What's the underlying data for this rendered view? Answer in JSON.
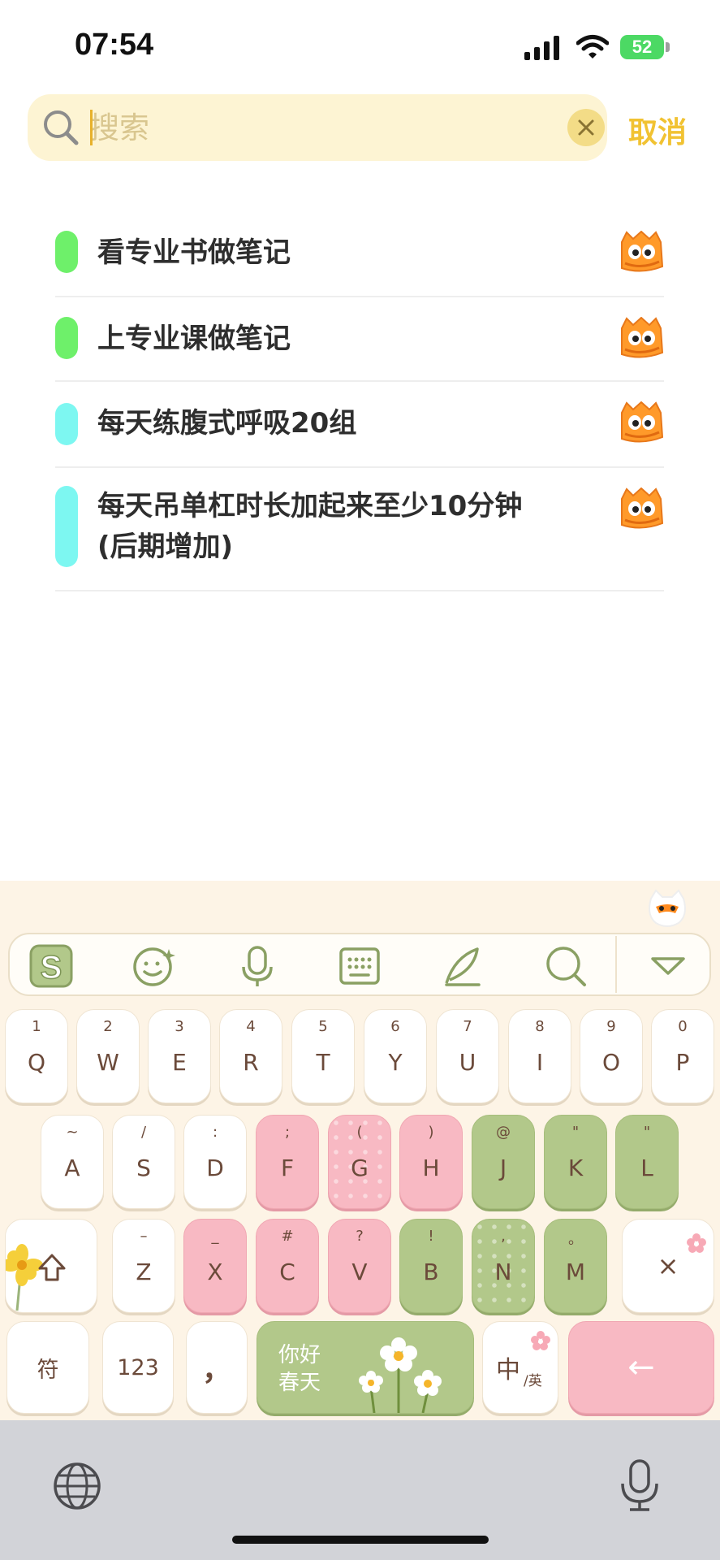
{
  "status_bar": {
    "time": "07:54",
    "battery": "52"
  },
  "search": {
    "placeholder": "搜索",
    "cancel_label": "取消"
  },
  "list": [
    {
      "title": "看专业书做笔记",
      "color": "#6ef06a"
    },
    {
      "title": "上专业课做笔记",
      "color": "#6ef06a"
    },
    {
      "title": "每天练腹式呼吸20组",
      "color": "#7df7f1"
    },
    {
      "title": "每天吊单杠时长加起来至少10分钟\n(后期增加)",
      "color": "#7df7f1"
    }
  ],
  "keyboard": {
    "row1": [
      {
        "sub": "1",
        "main": "Q"
      },
      {
        "sub": "2",
        "main": "W"
      },
      {
        "sub": "3",
        "main": "E"
      },
      {
        "sub": "4",
        "main": "R"
      },
      {
        "sub": "5",
        "main": "T"
      },
      {
        "sub": "6",
        "main": "Y"
      },
      {
        "sub": "7",
        "main": "U"
      },
      {
        "sub": "8",
        "main": "I"
      },
      {
        "sub": "9",
        "main": "O"
      },
      {
        "sub": "0",
        "main": "P"
      }
    ],
    "row2": [
      {
        "sub": "~",
        "main": "A"
      },
      {
        "sub": "/",
        "main": "S"
      },
      {
        "sub": ":",
        "main": "D"
      },
      {
        "sub": ";",
        "main": "F"
      },
      {
        "sub": "(",
        "main": "G"
      },
      {
        "sub": ")",
        "main": "H"
      },
      {
        "sub": "@",
        "main": "J"
      },
      {
        "sub": "\"",
        "main": "K"
      },
      {
        "sub": "\"",
        "main": "L"
      }
    ],
    "row3": [
      {
        "sub": "–",
        "main": "Z"
      },
      {
        "sub": "_",
        "main": "X"
      },
      {
        "sub": "#",
        "main": "C"
      },
      {
        "sub": "?",
        "main": "V"
      },
      {
        "sub": "!",
        "main": "B"
      },
      {
        "sub": ",",
        "main": "N"
      },
      {
        "sub": "。",
        "main": "M"
      }
    ],
    "delete_label": "×",
    "symbols_label": "符",
    "numbers_label": "123",
    "comma_label": "，",
    "space_line1": "你好",
    "space_line2": "春天",
    "lang_main": "中",
    "lang_sub": "/英",
    "enter_label": "←"
  },
  "colors": {
    "accent": "#f1c232",
    "pink_key": "#f8b9c3",
    "green_key": "#b2c88a"
  },
  "icons": [
    "search-icon",
    "clear-icon",
    "mascot-icon",
    "sogou-logo-icon",
    "emoji-icon",
    "mic-icon",
    "keyboard-icon",
    "pen-icon",
    "search-icon",
    "collapse-icon",
    "shift-icon",
    "globe-icon",
    "mic-icon"
  ]
}
